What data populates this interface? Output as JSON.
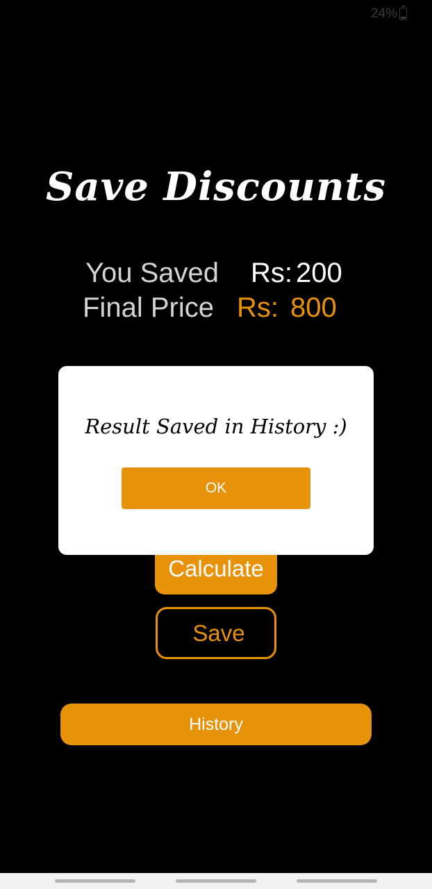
{
  "status_bar": {
    "battery_text": "24%",
    "battery_icon": "battery-icon"
  },
  "app": {
    "title": "Save Discounts"
  },
  "results": {
    "saved_label": "You Saved",
    "saved_currency": "Rs:",
    "saved_value": "200",
    "final_label": "Final Price",
    "final_currency": "Rs:",
    "final_value": "800"
  },
  "buttons": {
    "calculate": "Calculate",
    "save": "Save",
    "history": "History"
  },
  "dialog": {
    "message": "Result Saved in History :)",
    "ok_label": "OK"
  },
  "colors": {
    "accent": "#e8920a",
    "background": "#000000",
    "dialog_background": "#ffffff"
  }
}
